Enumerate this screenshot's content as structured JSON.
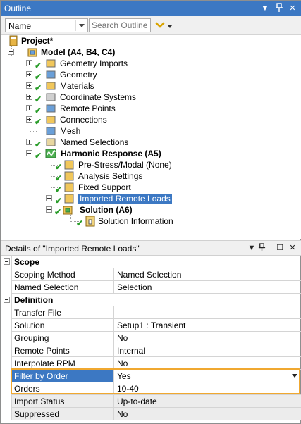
{
  "outline": {
    "title": "Outline",
    "controls": {
      "dropdown": "▼",
      "pin": "📌",
      "close": "✕"
    },
    "filter_select": "Name",
    "search_placeholder": "Search Outline"
  },
  "tree": {
    "project": "Project*",
    "model": "Model (A4, B4, C4)",
    "model_children": [
      "Geometry Imports",
      "Geometry",
      "Materials",
      "Coordinate Systems",
      "Remote Points",
      "Connections",
      "Mesh",
      "Named Selections"
    ],
    "analysis": "Harmonic Response (A5)",
    "analysis_children": [
      "Pre-Stress/Modal (None)",
      "Analysis Settings",
      "Fixed Support",
      "Imported Remote Loads"
    ],
    "solution": "Solution (A6)",
    "solution_children": [
      "Solution Information"
    ]
  },
  "details": {
    "title": "Details of \"Imported Remote Loads\"",
    "controls": {
      "dropdown": "▼",
      "pin": "📌",
      "maximize": "☐",
      "close": "✕"
    },
    "rows": [
      {
        "key": "Scope",
        "category": true
      },
      {
        "key": "Scoping Method",
        "value": "Named Selection"
      },
      {
        "key": "Named Selection",
        "value": "Selection"
      },
      {
        "key": "Definition",
        "category": true
      },
      {
        "key": "Transfer File",
        "value": ""
      },
      {
        "key": "Solution",
        "value": "Setup1 : Transient"
      },
      {
        "key": "Grouping",
        "value": "No"
      },
      {
        "key": "Remote Points",
        "value": "Internal"
      },
      {
        "key": "Interpolate RPM",
        "value": "No"
      },
      {
        "key": "Filter by Order",
        "value": "Yes"
      },
      {
        "key": "Orders",
        "value": "10-40"
      },
      {
        "key": "Import Status",
        "value": "Up-to-date"
      },
      {
        "key": "Suppressed",
        "value": "No"
      }
    ]
  },
  "colors": {
    "accent": "#3c78c3",
    "highlight": "#f0a830",
    "check": "#2a9d2a"
  }
}
